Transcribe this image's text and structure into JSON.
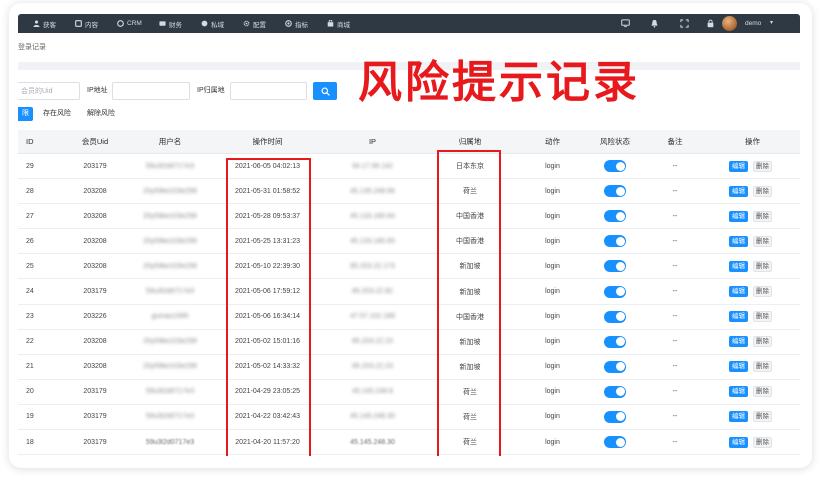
{
  "nav": {
    "items": [
      {
        "icon": "user-icon",
        "label": "获客"
      },
      {
        "icon": "content-icon",
        "label": "内容"
      },
      {
        "icon": "crm-icon",
        "label": "CRM"
      },
      {
        "icon": "finance-icon",
        "label": "财务"
      },
      {
        "icon": "private-domain-icon",
        "label": "私域"
      },
      {
        "icon": "settings-icon",
        "label": "配置"
      },
      {
        "icon": "metrics-icon",
        "label": "指标"
      },
      {
        "icon": "shop-icon",
        "label": "商城"
      }
    ],
    "right_icons": [
      "screen-icon",
      "bell-icon",
      "fullscreen-icon",
      "lock-icon"
    ],
    "user_name": "demo",
    "caret": "▾"
  },
  "breadcrumb": "登录记录",
  "overlay_title": "风险提示记录",
  "search": {
    "uid_placeholder": "会员的Uid",
    "ip_label": "IP地址",
    "location_label": "IP归属地",
    "button_icon": "search-icon"
  },
  "tabs": [
    {
      "label": "限",
      "active": true
    },
    {
      "label": "存在风险",
      "active": false
    },
    {
      "label": "解除风险",
      "active": false
    }
  ],
  "table": {
    "headers": [
      "ID",
      "会员Uid",
      "用户名",
      "操作时间",
      "IP",
      "归属地",
      "动作",
      "风险状态",
      "备注",
      "操作"
    ],
    "edit_label": "编辑",
    "delete_label": "删除",
    "rows": [
      {
        "id": "29",
        "member_uid": "203179",
        "username": "59u3l2d0717e3",
        "operation_time": "2021-06-05 04:02:13",
        "ip": "94.17.58.142",
        "location": "日本东京",
        "action": "login",
        "risk_enabled": true,
        "remark": "--"
      },
      {
        "id": "28",
        "member_uid": "203208",
        "username": "20y59ke103e299",
        "operation_time": "2021-05-31 01:58:52",
        "ip": "45.135.248.66",
        "location": "荷兰",
        "action": "login",
        "risk_enabled": true,
        "remark": "--"
      },
      {
        "id": "27",
        "member_uid": "203208",
        "username": "20y59ke103e299",
        "operation_time": "2021-05-28 09:53:37",
        "ip": "45.133.180.64",
        "location": "中国香港",
        "action": "login",
        "risk_enabled": true,
        "remark": "--"
      },
      {
        "id": "26",
        "member_uid": "203208",
        "username": "20y59ke103e299",
        "operation_time": "2021-05-25 13:31:23",
        "ip": "45.133.180.65",
        "location": "中国香港",
        "action": "login",
        "risk_enabled": true,
        "remark": "--"
      },
      {
        "id": "25",
        "member_uid": "203208",
        "username": "20y59ke103e299",
        "operation_time": "2021-05-10 22:39:30",
        "ip": "85.203.22.173",
        "location": "新加坡",
        "action": "login",
        "risk_enabled": true,
        "remark": "--"
      },
      {
        "id": "24",
        "member_uid": "203179",
        "username": "59u3l2d0717e3",
        "operation_time": "2021-05-06 17:59:12",
        "ip": "85.203.22.82",
        "location": "新加坡",
        "action": "login",
        "risk_enabled": true,
        "remark": "--"
      },
      {
        "id": "23",
        "member_uid": "203226",
        "username": "gumao1995",
        "operation_time": "2021-05-06 16:34:14",
        "ip": "47.57.102.189",
        "location": "中国香港",
        "action": "login",
        "risk_enabled": true,
        "remark": "--"
      },
      {
        "id": "22",
        "member_uid": "203208",
        "username": "20y59ke103e299",
        "operation_time": "2021-05-02 15:01:16",
        "ip": "85.203.22.23",
        "location": "新加坡",
        "action": "login",
        "risk_enabled": true,
        "remark": "--"
      },
      {
        "id": "21",
        "member_uid": "203208",
        "username": "20y59ke103e299",
        "operation_time": "2021-05-02 14:33:32",
        "ip": "85.203.22.23",
        "location": "新加坡",
        "action": "login",
        "risk_enabled": true,
        "remark": "--"
      },
      {
        "id": "20",
        "member_uid": "203179",
        "username": "59u3l2d0717e3",
        "operation_time": "2021-04-29 23:05:25",
        "ip": "45.145.248.8",
        "location": "荷兰",
        "action": "login",
        "risk_enabled": true,
        "remark": "--"
      },
      {
        "id": "19",
        "member_uid": "203179",
        "username": "59u3l2d0717e3",
        "operation_time": "2021-04-22 03:42:43",
        "ip": "45.145.248.30",
        "location": "荷兰",
        "action": "login",
        "risk_enabled": true,
        "remark": "--"
      },
      {
        "id": "18",
        "member_uid": "203179",
        "username": "59u3l2d0717e3",
        "operation_time": "2021-04-20 11:57:20",
        "ip": "45.145.248.30",
        "location": "荷兰",
        "action": "login",
        "risk_enabled": true,
        "remark": "--"
      }
    ]
  },
  "colors": {
    "accent": "#1890ff",
    "highlight": "#e8191c",
    "nav_bg": "#2f3944"
  }
}
